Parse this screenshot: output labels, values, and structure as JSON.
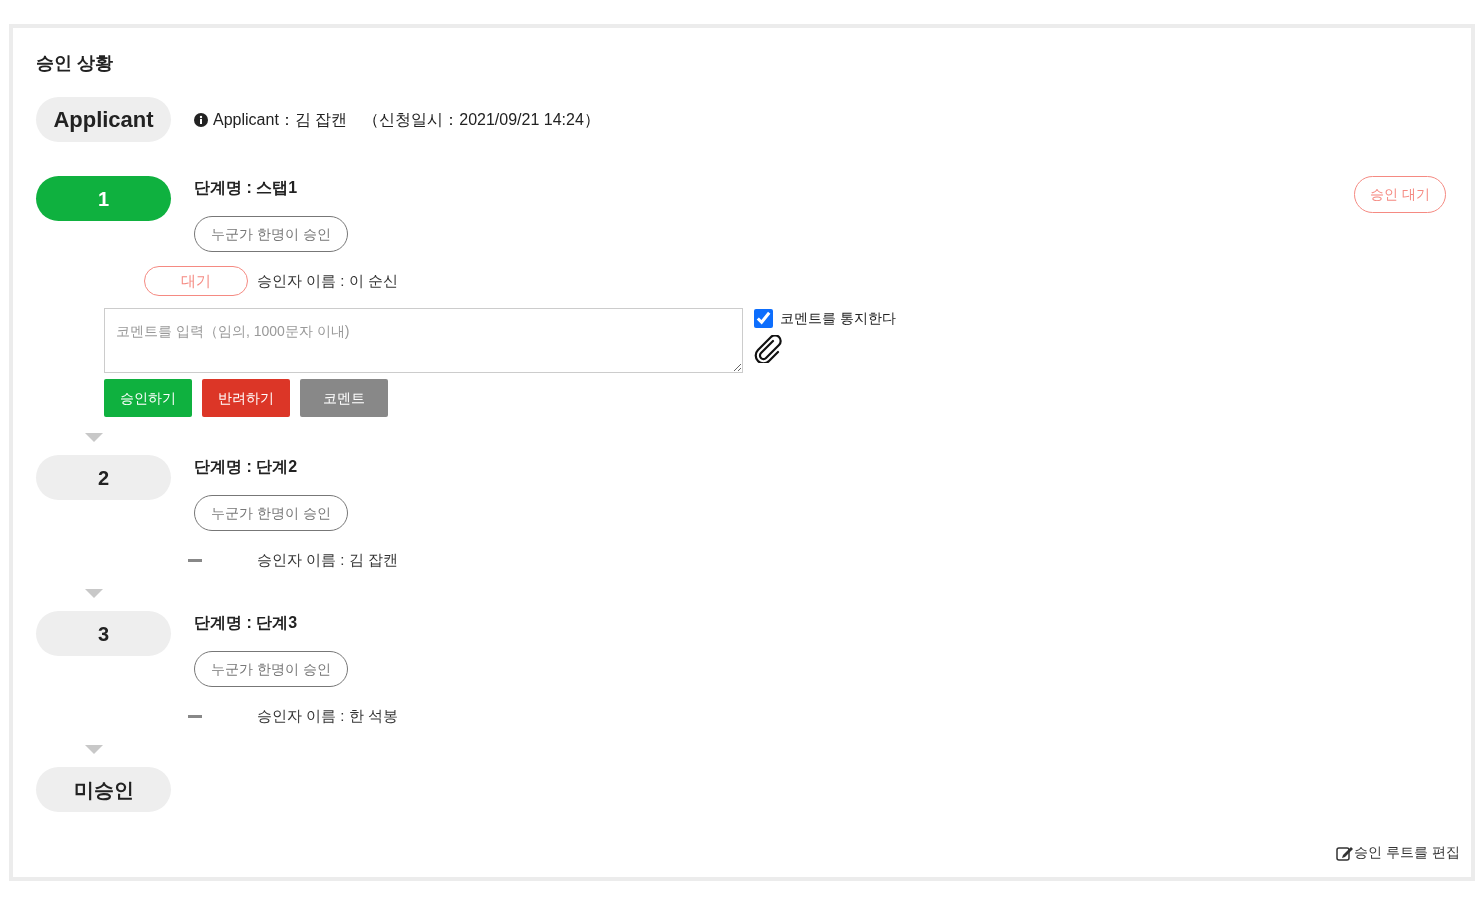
{
  "title": "승인 상황",
  "applicant": {
    "badge": "Applicant",
    "info": "Applicant：김 잡캔　（신청일시：2021/09/21 14:24）"
  },
  "steps": [
    {
      "number": "1",
      "active": true,
      "name": "단계명 : 스탭1",
      "rule": "누군가 한명이 승인",
      "status": "승인 대기",
      "approvers": [
        {
          "kind": "waiting",
          "status": "대기",
          "name": "승인자 이름 : 이 순신"
        }
      ],
      "comment": {
        "placeholder": "코멘트를 입력（임의, 1000문자 이내)",
        "notify_label": "코멘트를 통지한다",
        "notify": true
      },
      "buttons": [
        {
          "kind": "approve",
          "label": "승인하기"
        },
        {
          "kind": "reject",
          "label": "반려하기"
        },
        {
          "kind": "comment",
          "label": "코멘트"
        }
      ]
    },
    {
      "number": "2",
      "active": false,
      "name": "단계명 : 단계2",
      "rule": "누군가 한명이 승인",
      "approvers": [
        {
          "kind": "idle",
          "name": "승인자 이름 : 김 잡캔"
        }
      ]
    },
    {
      "number": "3",
      "active": false,
      "name": "단계명 : 단계3",
      "rule": "누군가 한명이 승인",
      "approvers": [
        {
          "kind": "idle",
          "name": "승인자 이름 : 한 석봉"
        }
      ]
    }
  ],
  "final": {
    "label": "미승인"
  },
  "edit_link": "승인 루트를 편집"
}
